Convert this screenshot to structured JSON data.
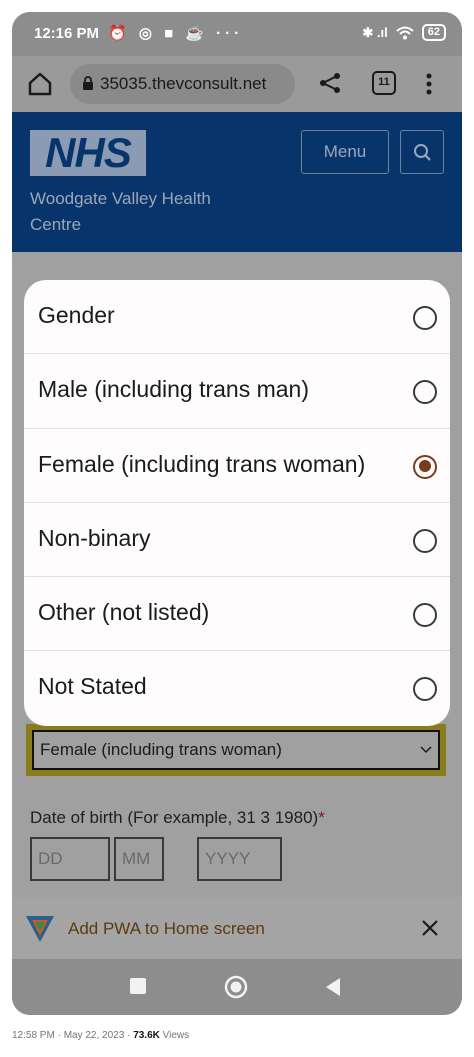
{
  "status_bar": {
    "time": "12:16 PM",
    "left_icons": "⏰ ◎ ■ ☕ ···",
    "signal_text": "✱ .ıl",
    "battery": "62"
  },
  "browser": {
    "url": "35035.thevconsult.net",
    "tab_count": "11"
  },
  "site": {
    "logo_text": "NHS",
    "org_name": "Woodgate Valley Health Centre",
    "menu_label": "Menu"
  },
  "page": {
    "gender_selected": "Female (including trans woman)",
    "dob_label": "Date of birth (For example, 31 3 1980)",
    "dob_required": "*",
    "dob_dd_placeholder": "DD",
    "dob_mm_placeholder": "MM",
    "dob_yyyy_placeholder": "YYYY"
  },
  "dialog": {
    "options": [
      {
        "label": "Gender",
        "checked": false
      },
      {
        "label": "Male (including trans man)",
        "checked": false
      },
      {
        "label": "Female (including trans woman)",
        "checked": true
      },
      {
        "label": "Non-binary",
        "checked": false
      },
      {
        "label": "Other (not listed)",
        "checked": false
      },
      {
        "label": "Not Stated",
        "checked": false
      }
    ]
  },
  "pwa_banner": {
    "text": "Add PWA to Home screen"
  },
  "tweet": {
    "timestamp": "12:58 PM · May 22, 2023 ·",
    "views_count": "73.6K",
    "views_label": "Views"
  },
  "colors": {
    "nhs_blue": "#07356b",
    "radio_selected": "#7b3a1a",
    "focus_yellow": "#8a7b1c"
  }
}
